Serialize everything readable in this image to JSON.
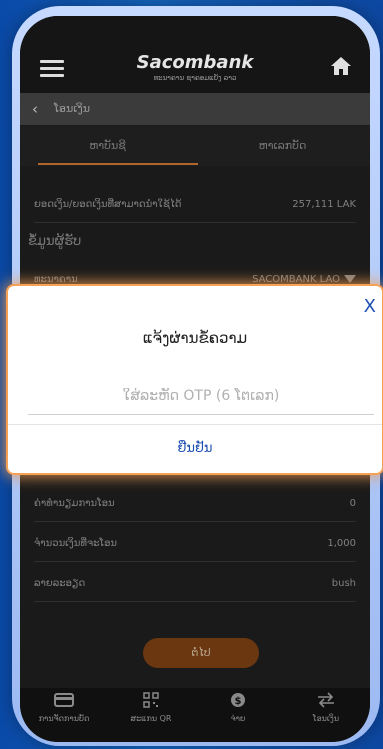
{
  "header": {
    "brand": "Sacombank",
    "brand_sub": "ທະນາຄານ ຊາຄອມແບັງ ລາວ"
  },
  "nav": {
    "back_title": "ໂອນເງິນ"
  },
  "tabs": [
    {
      "label": "ຫາບັນຊີ"
    },
    {
      "label": "ຫາເລກບັດ"
    }
  ],
  "form": {
    "balance_label": "ຍອດເງິນ/ຍອດເງິນທີ່ສາມາດນຳໃຊ້ໄດ້",
    "balance_value": "257,111 LAK",
    "section_title": "ຂໍ້ມູນຜູ້ຮັບ",
    "bank_label": "ທະນາຄານ",
    "bank_value": "SACOMBANK LAO",
    "fee_label": "ຄ່າທຳນຽມການໂອນ",
    "fee_value": "0",
    "amount_label": "ຈຳນວນເງິນທີ່ຈະໂອນ",
    "amount_value": "1,000",
    "desc_label": "ລາຍລະອຽດ",
    "desc_value": "bush",
    "confirm_label": "ຕໍ່ໄປ"
  },
  "bottom_nav": [
    {
      "label": "ການຈັດການບັດ",
      "icon": "card-icon"
    },
    {
      "label": "ສະແກນ QR",
      "icon": "qr-icon"
    },
    {
      "label": "ຈ່າຍ",
      "icon": "pay-icon"
    },
    {
      "label": "ໂອນເງິນ",
      "icon": "transfer-icon"
    }
  ],
  "dialog": {
    "close_label": "X",
    "title": "ແຈ້ງຜ່ານຂໍ້ຄວາມ",
    "otp_placeholder": "ໃສ່ລະຫັດ OTP (6 ໂຕເລກ)",
    "otp_value": "",
    "confirm_label": "ຢືນຢັນ"
  },
  "colors": {
    "accent": "#1f4fb0",
    "glow": "#f5a156",
    "button": "#6a3710"
  }
}
